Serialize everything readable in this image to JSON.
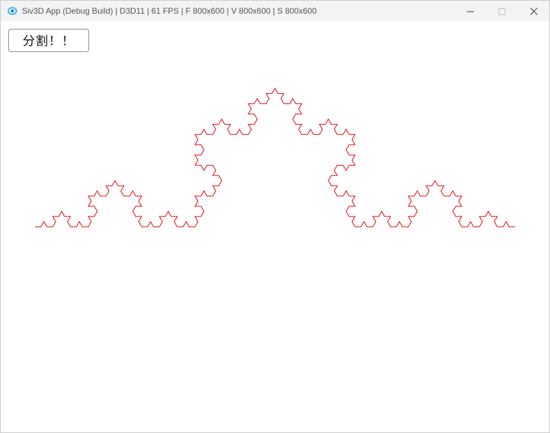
{
  "window": {
    "title": "Siv3D App (Debug Build) | D3D11 | 61 FPS | F 800x600 | V 800x600 | S 800x600",
    "app_icon": "siv3d-eye-icon"
  },
  "titlebar_controls": {
    "minimize_icon": "minimize-icon",
    "maximize_icon": "maximize-icon",
    "close_icon": "close-icon"
  },
  "canvas": {
    "button_label": "分割！！",
    "curve_color": "#e00000",
    "curve_type": "koch-curve"
  }
}
